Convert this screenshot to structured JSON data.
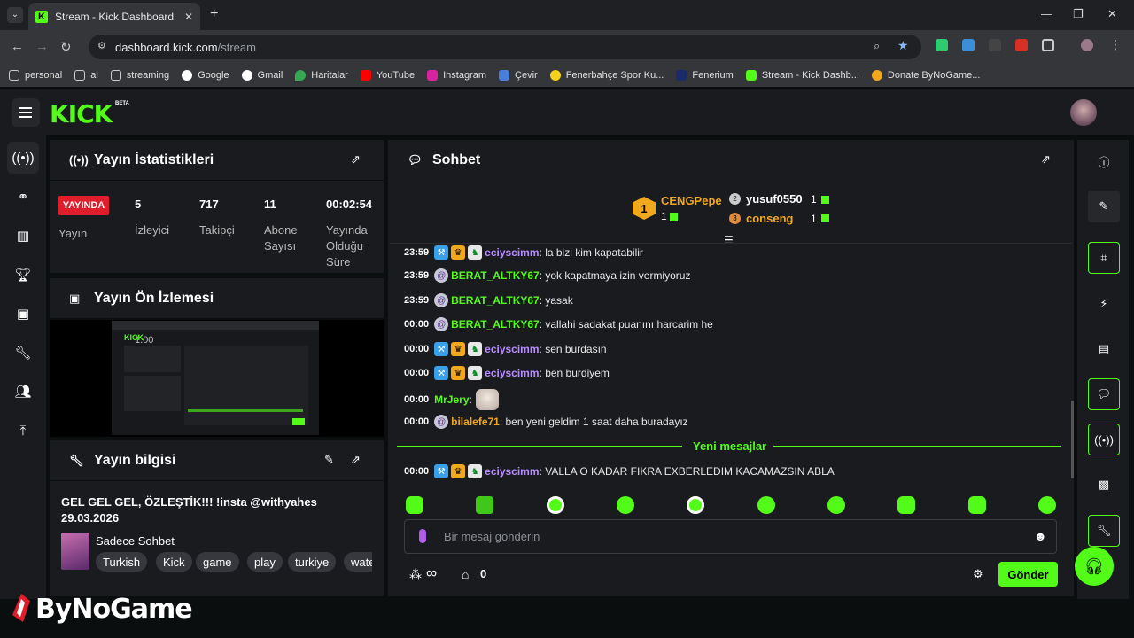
{
  "browser": {
    "tab_title": "Stream - Kick Dashboard",
    "url_host": "dashboard.kick.com",
    "url_path": "/stream",
    "bookmarks": [
      "personal",
      "ai",
      "streaming",
      "Google",
      "Gmail",
      "Haritalar",
      "YouTube",
      "Instagram",
      "Çevir",
      "Fenerbahçe Spor Ku...",
      "Fenerium",
      "Stream - Kick Dashb...",
      "Donate ByNoGame..."
    ]
  },
  "header": {
    "logo": "KICK",
    "beta": "BETA"
  },
  "stats": {
    "title": "Yayın İstatistikleri",
    "live_badge": "YAYINDA",
    "live_label": "Yayın",
    "viewers": "5",
    "viewers_label": "İzleyici",
    "followers": "717",
    "followers_label": "Takipçi",
    "subs": "11",
    "subs_label_1": "Abone",
    "subs_label_2": "Sayısı",
    "uptime": "00:02:54",
    "uptime_label_1": "Yayında",
    "uptime_label_2": "Olduğu",
    "uptime_label_3": "Süre"
  },
  "preview": {
    "title": "Yayın Ön İzlemesi",
    "overlay_number": "1.00"
  },
  "info": {
    "title": "Yayın bilgisi",
    "stream_title_1": "GEL GEL GEL, ÖZLEŞTİK!!! !insta @withyahes",
    "stream_title_2": "29.03.2026",
    "category": "Sadece Sohbet",
    "tags": [
      "Turkish",
      "Kick",
      "game",
      "play",
      "turkiye",
      "wate"
    ]
  },
  "chat": {
    "title": "Sohbet",
    "top_gifters": [
      {
        "rank": "1",
        "name": "CENGPepe",
        "count": "1"
      },
      {
        "rank": "2",
        "name": "yusuf0550",
        "count": "1"
      },
      {
        "rank": "3",
        "name": "conseng",
        "count": "1"
      }
    ],
    "messages": [
      {
        "time": "23:59",
        "user": "eciyscimm",
        "text": ": la bizi kim kapatabilir"
      },
      {
        "time": "23:59",
        "user": "BERAT_ALTKY67",
        "text": ": yok kapatmaya izin vermiyoruz"
      },
      {
        "time": "23:59",
        "user": "BERAT_ALTKY67",
        "text": ": yasak"
      },
      {
        "time": "00:00",
        "user": "BERAT_ALTKY67",
        "text": ": vallahi sadakat puanını harcarim he"
      },
      {
        "time": "00:00",
        "user": "eciyscimm",
        "text": ": sen burdasın"
      },
      {
        "time": "00:00",
        "user": "eciyscimm",
        "text": ": ben burdiyem"
      },
      {
        "time": "00:00",
        "user": "MrJery",
        "text": ":"
      },
      {
        "time": "00:00",
        "user": "bilalefe71",
        "text": ": ben yeni geldim 1 saat daha buradayız"
      }
    ],
    "new_messages_label": "Yeni mesajlar",
    "new_message": {
      "time": "00:00",
      "user": "eciyscimm",
      "text": ": VALLA O KADAR FIKRA EXBERLEDIM KACAMAZSIN ABLA"
    },
    "input_placeholder": "Bir mesaj gönderin",
    "points": "∞",
    "store_count": "0",
    "send_label": "Gönder",
    "colors": {
      "green_user": "#53fc18",
      "purple_user": "#b98cff",
      "orange_user": "#f2a81d",
      "accent": "#53fc18"
    }
  },
  "watermark": {
    "brand": "ByNoGame"
  }
}
